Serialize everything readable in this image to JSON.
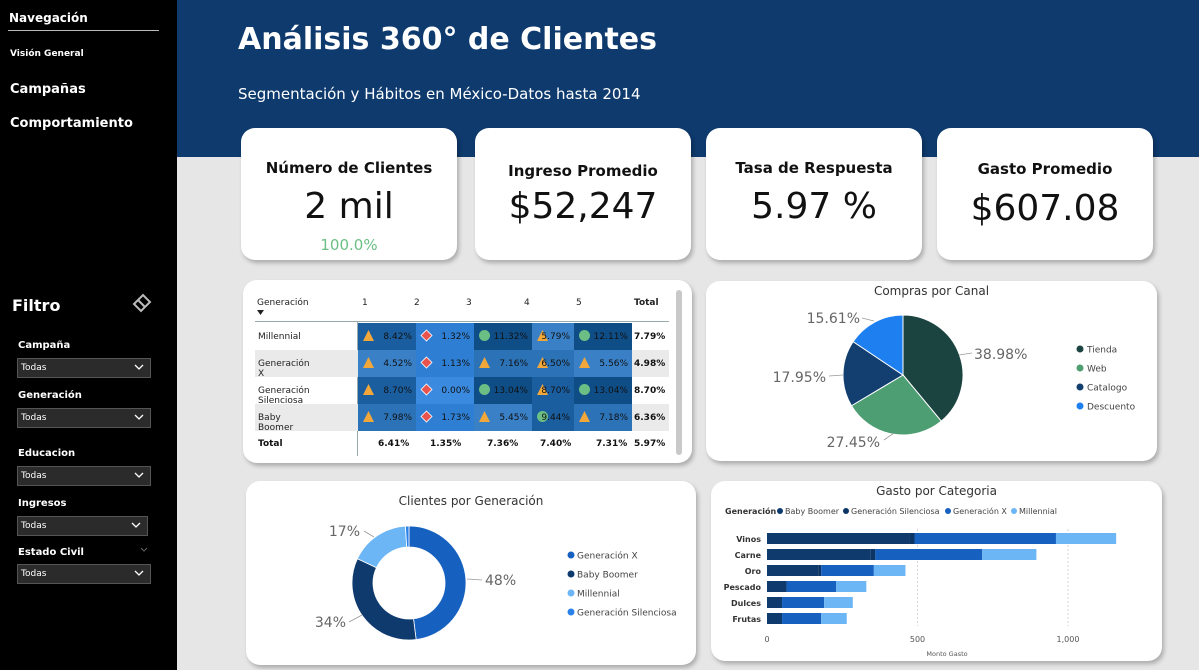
{
  "nav": {
    "title": "Navegación",
    "items": [
      "Visión General",
      "Campañas",
      "Comportamiento"
    ]
  },
  "filters": {
    "title": "Filtro",
    "items": [
      {
        "label": "Campaña",
        "value": "Todas"
      },
      {
        "label": "Generación",
        "value": "Todas"
      },
      {
        "label": "Educacion",
        "value": "Todas"
      },
      {
        "label": "Ingresos",
        "value": "Todas"
      },
      {
        "label": "Estado Civil",
        "value": "Todas"
      }
    ]
  },
  "header": {
    "title": "Análisis 360° de Clientes",
    "subtitle": "Segmentación y Hábitos en México-Datos hasta 2014"
  },
  "kpis": [
    {
      "label": "Número de Clientes",
      "value": "2 mil",
      "sub": "100.0%"
    },
    {
      "label": "Ingreso Promedio",
      "value": "$52,247"
    },
    {
      "label": "Tasa de Respuesta",
      "value": "5.97 %"
    },
    {
      "label": "Gasto Promedio",
      "value": "$607.08"
    }
  ],
  "matrix": {
    "header_label": "Generación",
    "columns": [
      "1",
      "2",
      "3",
      "4",
      "5",
      "Total"
    ],
    "rows": [
      {
        "label": "Millennial",
        "cells": [
          "8.42%",
          "1.32%",
          "11.32%",
          "5.79%",
          "12.11%"
        ],
        "total": "7.79%"
      },
      {
        "label": "Generación X",
        "cells": [
          "4.52%",
          "1.13%",
          "7.16%",
          "6.50%",
          "5.56%"
        ],
        "total": "4.98%"
      },
      {
        "label": "Generación Silenciosa",
        "cells": [
          "8.70%",
          "0.00%",
          "13.04%",
          "8.70%",
          "13.04%"
        ],
        "total": "8.70%"
      },
      {
        "label": "Baby Boomer",
        "cells": [
          "7.98%",
          "1.73%",
          "5.45%",
          "9.44%",
          "7.18%"
        ],
        "total": "6.36%"
      }
    ],
    "totals_label": "Total",
    "totals": [
      "6.41%",
      "1.35%",
      "7.36%",
      "7.40%",
      "7.31%",
      "5.97%"
    ]
  },
  "colors": {
    "header": "#0e3a6e",
    "tienda": "#1b4440",
    "web": "#4e9e74",
    "catalogo": "#123e70",
    "descuento": "#1e80f0",
    "gen_x": "#1660c0",
    "baby_boomer": "#0e3a6e",
    "millennial": "#6cb6f5",
    "gen_silenciosa": "#2a82e8"
  },
  "chart_data": [
    {
      "type": "pie",
      "title": "Compras por Canal",
      "labels": [
        "Tienda",
        "Web",
        "Catalogo",
        "Descuento"
      ],
      "values": [
        38.98,
        27.45,
        17.95,
        15.61
      ],
      "value_labels": [
        "38.98%",
        "27.45%",
        "17.95%",
        "15.61%"
      ],
      "legend": "right"
    },
    {
      "type": "pie",
      "title": "Clientes por Generación",
      "donut": true,
      "labels": [
        "Generación X",
        "Baby Boomer",
        "Millennial",
        "Generación Silenciosa"
      ],
      "values": [
        48,
        34,
        17,
        1
      ],
      "value_labels": [
        "48%",
        "34%",
        "17%"
      ],
      "legend": "right"
    },
    {
      "type": "bar",
      "orientation": "horizontal",
      "stacked": true,
      "title": "Gasto por Categoria",
      "legend_title": "Generación",
      "legend": "top",
      "categories": [
        "Vinos",
        "Carne",
        "Oro",
        "Pescado",
        "Dulces",
        "Frutas"
      ],
      "series": [
        {
          "name": "Baby Boomer",
          "values": [
            475,
            345,
            170,
            65,
            50,
            50
          ]
        },
        {
          "name": "Generación Silenciosa",
          "values": [
            15,
            15,
            10,
            0,
            0,
            0
          ]
        },
        {
          "name": "Generación X",
          "values": [
            470,
            355,
            175,
            165,
            140,
            130
          ]
        },
        {
          "name": "Millennial",
          "values": [
            200,
            180,
            105,
            100,
            95,
            85
          ]
        }
      ],
      "xlabel": "Monto Gasto",
      "xticks": [
        "0",
        "500",
        "1,000"
      ],
      "xlim": [
        0,
        1200
      ]
    }
  ]
}
